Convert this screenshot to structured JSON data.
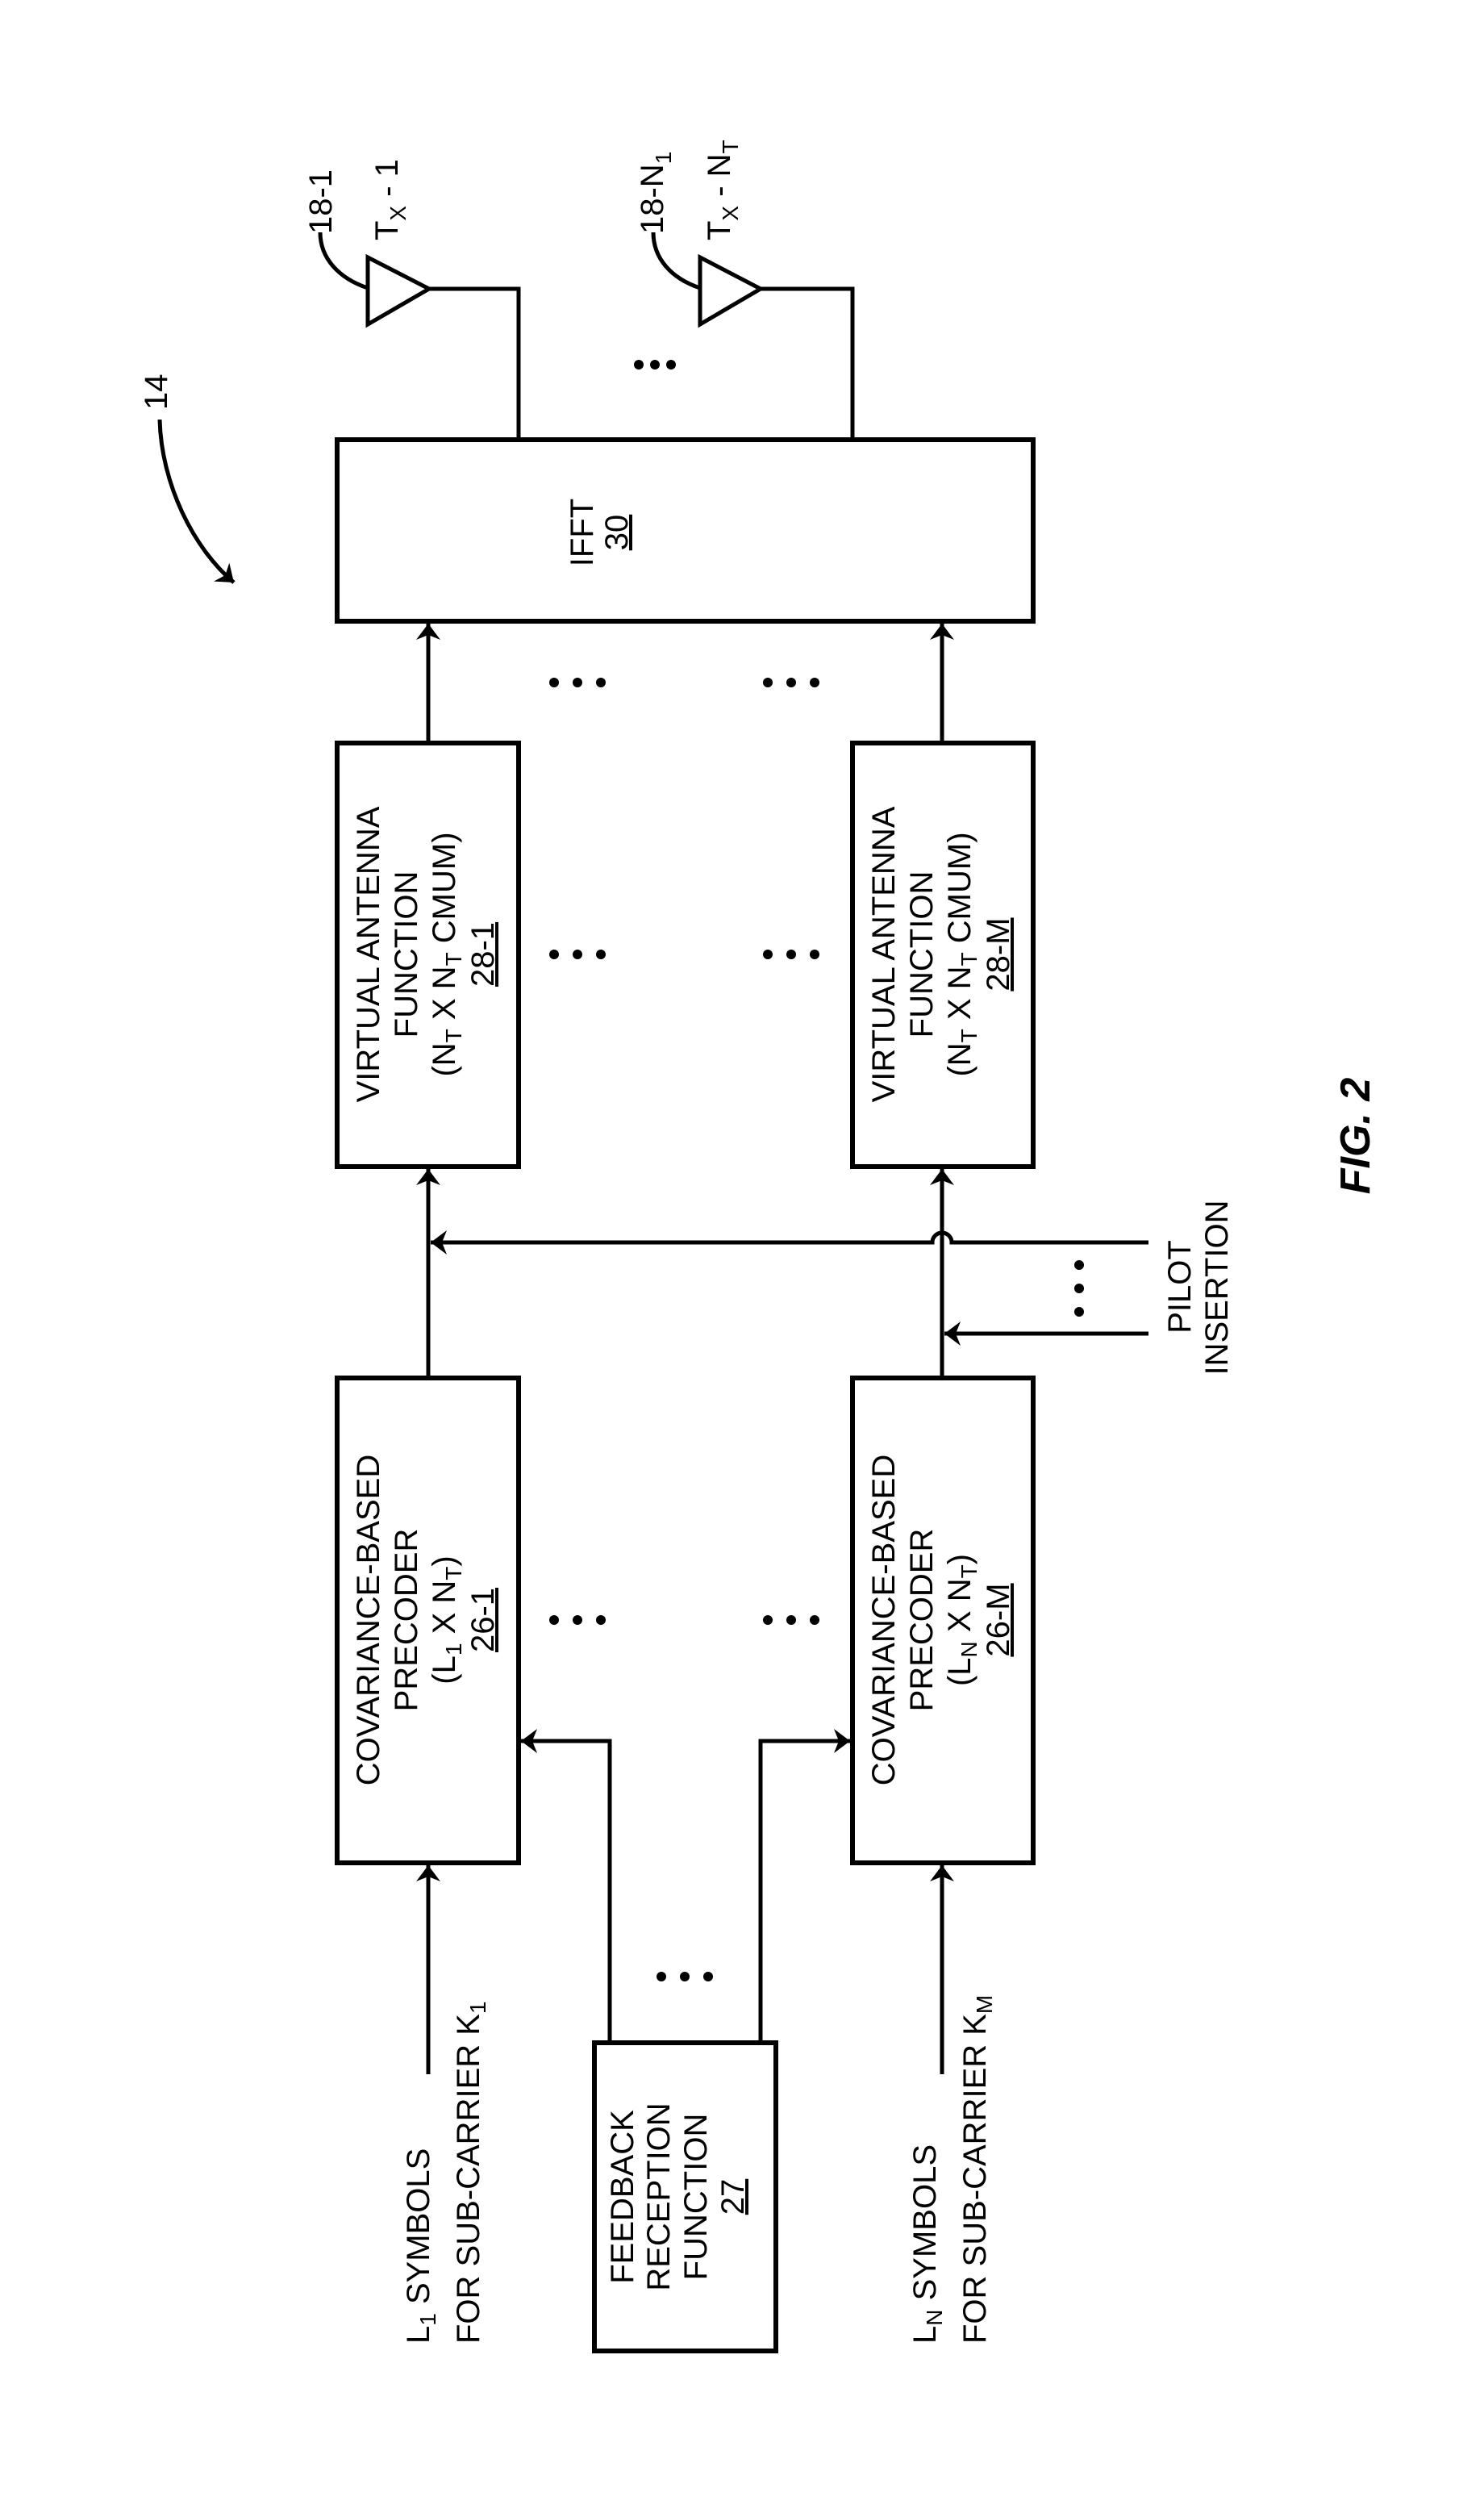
{
  "figure": {
    "title": "FIG. 2",
    "system_ref": "14"
  },
  "antennas": [
    {
      "ref": "18-1",
      "label_main": "T",
      "label_sub": "X",
      "label_tail": " - 1",
      "label_tail_sub": ""
    },
    {
      "ref": "18-N",
      "ref_sub": "1",
      "label_main": "T",
      "label_sub": "X",
      "label_tail": " - N",
      "label_tail_sub": "T"
    }
  ],
  "ifft": {
    "name": "IFFT",
    "ref": "30"
  },
  "virtual_antenna": [
    {
      "line1": "VIRTUAL ANTENNA",
      "line2": "FUNCTION",
      "line3_a": "(N",
      "line3_b": "T",
      "line3_c": " X N",
      "line3_d": "T",
      "line3_e": " CMUM)",
      "ref": "28-1"
    },
    {
      "line1": "VIRTUAL ANTENNA",
      "line2": "FUNCTION",
      "line3_a": "(N",
      "line3_b": "T",
      "line3_c": " X N",
      "line3_d": "T",
      "line3_e": " CMUM)",
      "ref": "28-M"
    }
  ],
  "precoders": [
    {
      "line1": "COVARIANCE-BASED",
      "line2": "PRECODER",
      "line3_a": "(L",
      "line3_b": "1",
      "line3_c": " X N",
      "line3_d": "T",
      "line3_e": ")",
      "ref": "26-1"
    },
    {
      "line1": "COVARIANCE-BASED",
      "line2": "PRECODER",
      "line3_a": "(L",
      "line3_b": "N",
      "line3_c": " X N",
      "line3_d": "T",
      "line3_e": ")",
      "ref": "26-M"
    }
  ],
  "feedback": {
    "line1": "FEEDBACK",
    "line2": "RECEPTION",
    "line3": "FUNCTION",
    "ref": "27"
  },
  "pilot": {
    "line1": "PILOT",
    "line2": "INSERTION"
  },
  "inputs": [
    {
      "a": "L",
      "a_sub": "1",
      "b": " SYMBOLS",
      "line2": "FOR SUB-CARRIER K",
      "line2_sub": "1"
    },
    {
      "a": "L",
      "a_sub": "N",
      "b": " SYMBOLS",
      "line2": "FOR SUB-CARRIER K",
      "line2_sub": "M"
    }
  ],
  "ellipsis": "..."
}
